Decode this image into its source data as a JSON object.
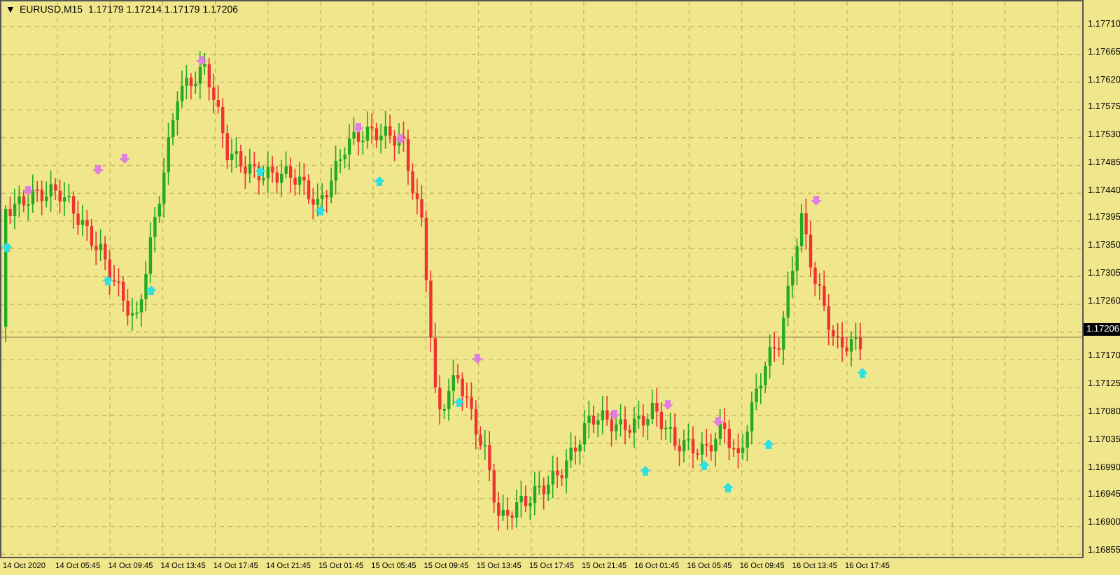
{
  "chart_header": {
    "collapse_glyph": "▼",
    "text": "EURUSD,M15  1.17179 1.17214 1.17179 1.17206"
  },
  "price_axis": {
    "labels": [
      "1.17710",
      "1.17665",
      "1.17620",
      "1.17575",
      "1.17530",
      "1.17485",
      "1.17440",
      "1.17395",
      "1.17350",
      "1.17305",
      "1.17260",
      "1.17170",
      "1.17125",
      "1.17080",
      "1.17035",
      "1.16990",
      "1.16945",
      "1.16900",
      "1.16855"
    ],
    "current_price": "1.17206"
  },
  "time_axis": {
    "labels": [
      "14 Oct 2020",
      "14 Oct 05:45",
      "14 Oct 09:45",
      "14 Oct 13:45",
      "14 Oct 17:45",
      "14 Oct 21:45",
      "15 Oct 01:45",
      "15 Oct 05:45",
      "15 Oct 09:45",
      "15 Oct 13:45",
      "15 Oct 17:45",
      "15 Oct 21:45",
      "16 Oct 01:45",
      "16 Oct 05:45",
      "16 Oct 09:45",
      "16 Oct 13:45",
      "16 Oct 17:45"
    ]
  }
}
